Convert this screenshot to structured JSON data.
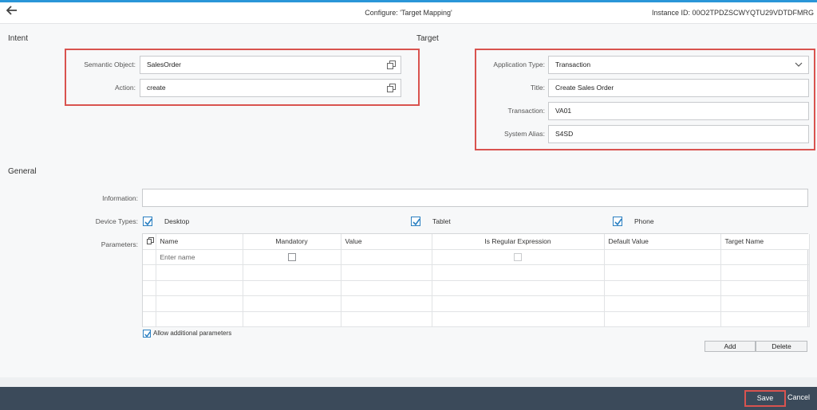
{
  "header": {
    "title": "Configure: 'Target Mapping'",
    "instance": "Instance ID: 00O2TPDZSCWYQTU29VDTDFMRG"
  },
  "intent": {
    "section_title": "Intent",
    "semantic_object_label": "Semantic Object:",
    "semantic_object_value": "SalesOrder",
    "action_label": "Action:",
    "action_value": "create"
  },
  "target": {
    "section_title": "Target",
    "application_type_label": "Application Type:",
    "application_type_value": "Transaction",
    "title_label": "Title:",
    "title_value": "Create Sales Order",
    "transaction_label": "Transaction:",
    "transaction_value": "VA01",
    "system_alias_label": "System Alias:",
    "system_alias_value": "S4SD"
  },
  "general": {
    "section_title": "General",
    "information_label": "Information:",
    "information_value": "",
    "device_types_label": "Device Types:",
    "devices": [
      {
        "label": "Desktop",
        "checked": true
      },
      {
        "label": "Tablet",
        "checked": true
      },
      {
        "label": "Phone",
        "checked": true
      }
    ],
    "parameters_label": "Parameters:",
    "columns": [
      "Name",
      "Mandatory",
      "Value",
      "Is Regular Expression",
      "Default Value",
      "Target Name"
    ],
    "first_row_name_placeholder": "Enter name",
    "allow_additional_label": "Allow additional parameters",
    "add_label": "Add",
    "delete_label": "Delete"
  },
  "footer": {
    "save_label": "Save",
    "cancel_label": "Cancel"
  },
  "colors": {
    "accent": "#2a96d8",
    "highlight": "#d9534f",
    "footer_bg": "#3b4a5a"
  }
}
